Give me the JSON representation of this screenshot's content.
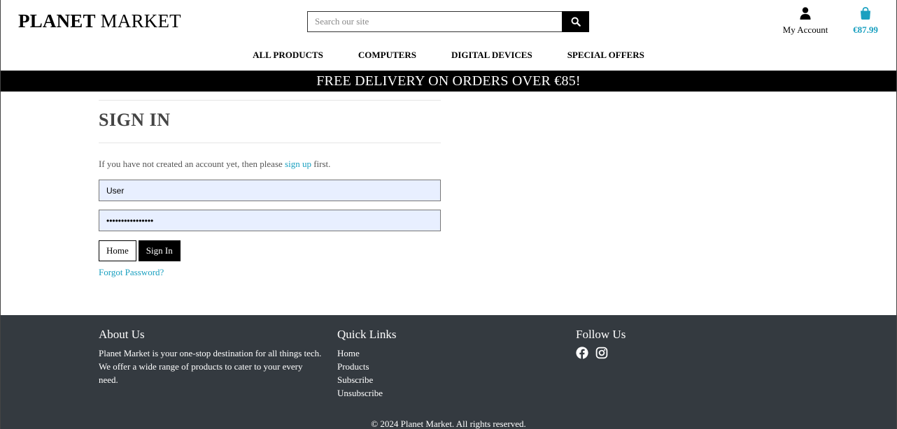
{
  "header": {
    "logo_bold": "PLANET",
    "logo_thin": "MARKET",
    "search": {
      "placeholder": "Search our site"
    },
    "account_label": "My Account",
    "bag_total": "€87.99"
  },
  "nav": {
    "items": [
      {
        "label": "ALL PRODUCTS"
      },
      {
        "label": "COMPUTERS"
      },
      {
        "label": "DIGITAL DEVICES"
      },
      {
        "label": "SPECIAL OFFERS"
      }
    ]
  },
  "banner": {
    "text": "FREE DELIVERY ON ORDERS OVER €85!"
  },
  "signin": {
    "title": "SIGN IN",
    "intro_before": "If you have not created an account yet, then please ",
    "intro_link": "sign up",
    "intro_after": " first.",
    "username_value": "User",
    "password_value": "••••••••••••••••",
    "home_label": "Home",
    "signin_label": "Sign In",
    "forgot_label": "Forgot Password?"
  },
  "footer": {
    "about": {
      "title": "About Us",
      "text": "Planet Market is your one-stop destination for all things tech. We offer a wide range of products to cater to your every need."
    },
    "quick_links": {
      "title": "Quick Links",
      "items": [
        {
          "label": "Home"
        },
        {
          "label": "Products"
        },
        {
          "label": "Subscribe"
        },
        {
          "label": "Unsubscribe"
        }
      ]
    },
    "follow": {
      "title": "Follow Us",
      "icons": [
        "facebook-icon",
        "instagram-icon"
      ]
    },
    "copyright": "© 2024 Planet Market. All rights reserved."
  },
  "colors": {
    "accent": "#1aa0c0",
    "footer_bg": "#343a40",
    "banner_bg": "#000000",
    "input_bg": "#e8efff"
  }
}
